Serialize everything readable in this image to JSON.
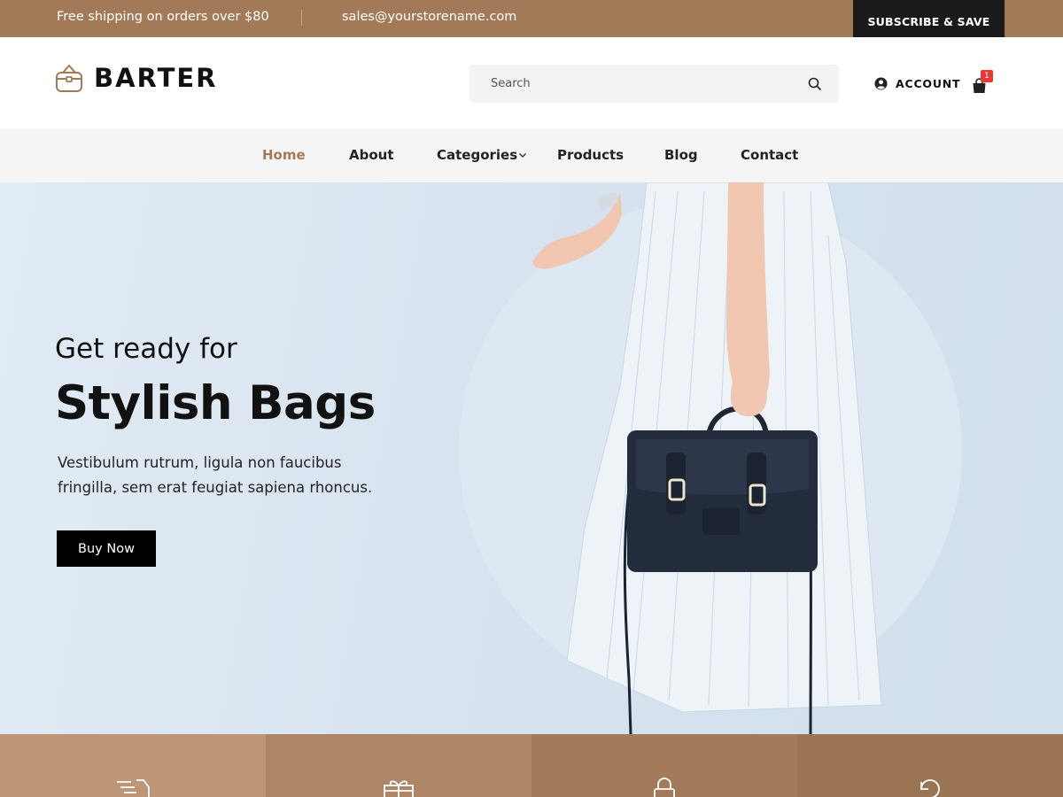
{
  "topbar": {
    "shipping_text": "Free shipping on orders over $80",
    "email": "sales@yourstorename.com",
    "subscribe_label": "SUBSCRIBE & SAVE",
    "bg_color": "#a37a57"
  },
  "header": {
    "logo_text": "BARTER",
    "search_placeholder": "Search",
    "account_label": "ACCOUNT",
    "cart_count": "1"
  },
  "nav": {
    "items": [
      {
        "label": "Home",
        "active": true
      },
      {
        "label": "About"
      },
      {
        "label": "Categories",
        "has_dropdown": true
      },
      {
        "label": "Products"
      },
      {
        "label": "Blog"
      },
      {
        "label": "Contact"
      }
    ],
    "active_color": "#a37a57"
  },
  "hero": {
    "subtitle": "Get ready for",
    "title": "Stylish Bags",
    "text": "Vestibulum rutrum, ligula non faucibus fringilla, sem erat feugiat sapiena rhoncus.",
    "button_label": "Buy Now"
  },
  "features": [
    {
      "icon": "truck-icon",
      "color": "#bc9677"
    },
    {
      "icon": "gift-icon",
      "color": "#ad8567"
    },
    {
      "icon": "lock-icon",
      "color": "#a37a5a"
    },
    {
      "icon": "return-icon",
      "color": "#9b7454"
    }
  ]
}
